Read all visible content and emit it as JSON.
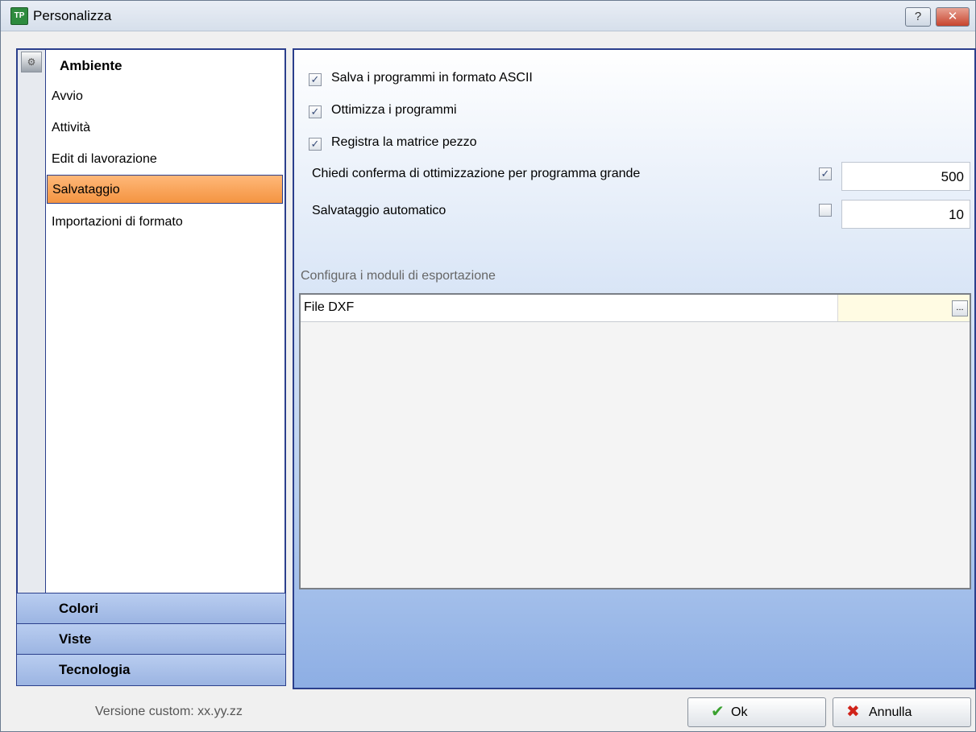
{
  "window": {
    "title": "Personalizza",
    "help_label": "?",
    "close_label": "✕"
  },
  "nav": {
    "heading": "Ambiente",
    "items": [
      {
        "label": "Avvio"
      },
      {
        "label": "Attività"
      },
      {
        "label": "Edit di lavorazione"
      },
      {
        "label": "Salvataggio",
        "selected": true
      },
      {
        "label": "Importazioni di formato"
      }
    ],
    "groups": [
      {
        "label": "Colori"
      },
      {
        "label": "Viste"
      },
      {
        "label": "Tecnologia"
      }
    ]
  },
  "options": {
    "ascii": {
      "label": "Salva i programmi in formato ASCII",
      "checked": true
    },
    "optimize": {
      "label": "Ottimizza i programmi",
      "checked": true
    },
    "matrix": {
      "label": "Registra la matrice pezzo",
      "checked": true
    }
  },
  "fields": {
    "confirm": {
      "label": "Chiedi conferma di ottimizzazione per programma grande",
      "checked": true,
      "value": "500"
    },
    "autosave": {
      "label": "Salvataggio automatico",
      "checked": false,
      "value": "10"
    }
  },
  "export": {
    "section_label": "Configura i moduli di esportazione",
    "rows": [
      {
        "name": "File DXF",
        "value": "",
        "button": "..."
      }
    ]
  },
  "footer": {
    "version": "Versione custom: xx.yy.zz",
    "ok_label": "Ok",
    "cancel_label": "Annulla"
  },
  "icons": {
    "app": "app-logo-icon",
    "section": "environment-icon",
    "ok": "checkmark-icon",
    "cancel": "x-icon"
  }
}
